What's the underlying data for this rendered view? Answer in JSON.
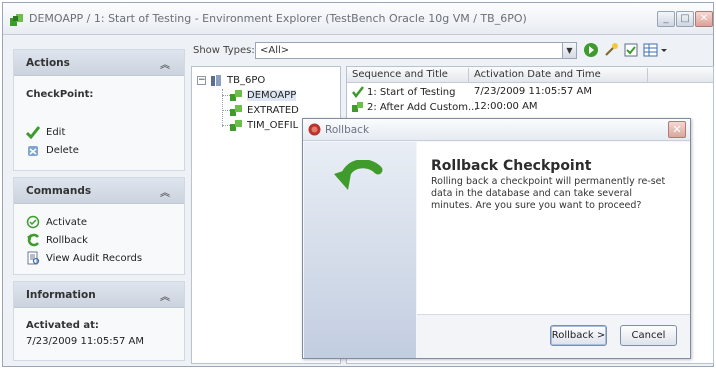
{
  "window": {
    "title": "DEMOAPP / 1: Start of Testing - Environment Explorer (TestBench Oracle 10g VM / TB_6PO)",
    "minimize": "_",
    "maximize": "□",
    "close": "✕"
  },
  "sidebar": {
    "actions": {
      "title": "Actions",
      "chevron": "︽",
      "object_label": "CheckPoint:",
      "items": [
        {
          "label": "Edit",
          "icon": "edit-check-icon"
        },
        {
          "label": "Delete",
          "icon": "delete-icon"
        }
      ]
    },
    "commands": {
      "title": "Commands",
      "chevron": "︽",
      "items": [
        {
          "label": "Activate",
          "icon": "activate-icon"
        },
        {
          "label": "Rollback",
          "icon": "rollback-icon"
        },
        {
          "label": "View Audit Records",
          "icon": "audit-records-icon"
        }
      ]
    },
    "information": {
      "title": "Information",
      "chevron": "︽",
      "activated_label": "Activated at:",
      "activated_value": "7/23/2009 11:05:57 AM"
    }
  },
  "toolbar": {
    "show_types_label": "Show Types:",
    "show_types_value": "<All>",
    "dropdown_arrow": "▼"
  },
  "tree": {
    "root": "TB_6PO",
    "expander": "−",
    "children": [
      "DEMOAPP",
      "EXTRATED",
      "TIM_OEFIL"
    ]
  },
  "grid": {
    "columns": [
      "Sequence and Title",
      "Activation Date and Time"
    ],
    "rows": [
      {
        "title": "1: Start of Testing",
        "date": "7/23/2009 11:05:57 AM"
      },
      {
        "title": "2: After Add Custom...",
        "date": "12:00:00 AM"
      }
    ]
  },
  "dialog": {
    "title": "Rollback",
    "close": "✕",
    "heading": "Rollback Checkpoint",
    "message": "Rolling back a checkpoint will permanently re-set data in the database and can take several minutes. Are you sure you want to proceed?",
    "rollback_button": "Rollback >",
    "cancel_button": "Cancel"
  },
  "colors": {
    "accent_green": "#3e9b2c",
    "panel_header": "#cbd3de",
    "dialog_border": "#7f8da3"
  }
}
